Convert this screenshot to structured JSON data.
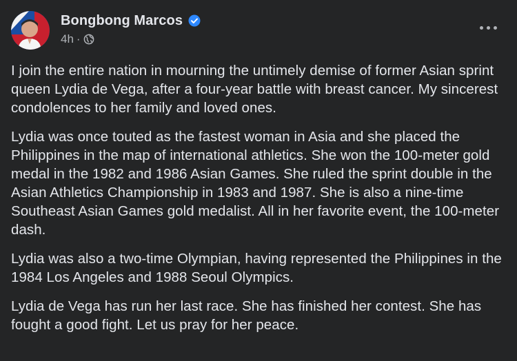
{
  "post": {
    "author": "Bongbong Marcos",
    "timestamp": "4h",
    "separator": "·",
    "verified_icon": "verified-badge-icon",
    "privacy_icon": "globe-icon",
    "more_icon": "more-dots-icon",
    "paragraphs": [
      "I join the entire nation in mourning the untimely demise of former Asian sprint queen Lydia de Vega, after a four-year battle with breast cancer. My sincerest condolences to her family and loved ones.",
      "Lydia was once touted as the fastest woman in Asia and she placed the Philippines in the map of international athletics. She won the 100-meter gold medal in the 1982 and 1986 Asian Games. She ruled the sprint double in the Asian Athletics Championship in 1983 and 1987. She is also a nine-time Southeast Asian Games gold medalist. All in her favorite event, the 100-meter dash.",
      "Lydia was also a two-time Olympian, having represented the Philippines in the 1984 Los Angeles and 1988 Seoul Olympics.",
      "Lydia de Vega has run her last race. She has finished her contest. She has fought a good fight. Let us pray for her peace."
    ]
  },
  "colors": {
    "background": "#242526",
    "primary_text": "#e4e6eb",
    "secondary_text": "#b0b3b8",
    "verified_blue": "#2d88ff"
  }
}
